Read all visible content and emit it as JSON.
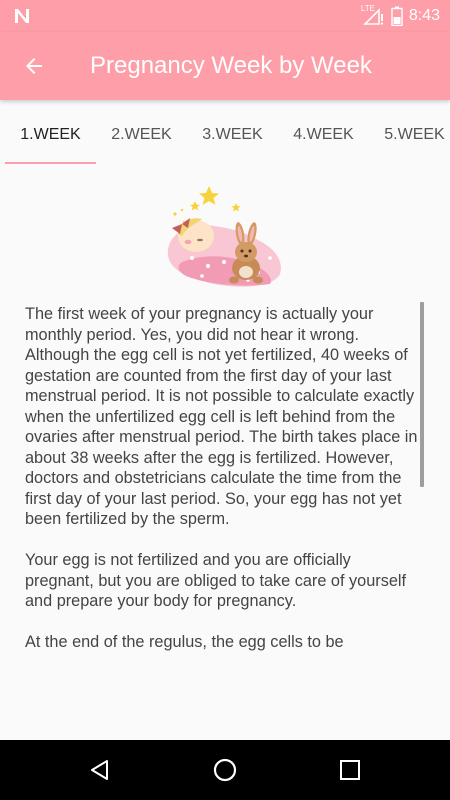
{
  "status_bar": {
    "network_label": "LTE",
    "time": "8:43"
  },
  "app_bar": {
    "title": "Pregnancy Week by Week"
  },
  "tabs": [
    {
      "label": "1.WEEK",
      "active": true
    },
    {
      "label": "2.WEEK",
      "active": false
    },
    {
      "label": "3.WEEK",
      "active": false
    },
    {
      "label": "4.WEEK",
      "active": false
    },
    {
      "label": "5.WEEK",
      "active": false
    }
  ],
  "article": {
    "paragraphs": [
      "The first week of your pregnancy is actually your monthly period. Yes, you did not hear it wrong. Although the egg cell is not yet fertilized, 40 weeks of gestation are counted from the first day of your last menstrual period. It is not possible to calculate exactly when the unfertilized egg cell is left behind from the ovaries after menstrual period. The birth takes place in about 38 weeks after the egg is fertilized. However, doctors and obstetricians calculate the time from the first day of your last period. So, your egg has not yet been fertilized by the sperm.",
      "Your egg is not fertilized and you are officially pregnant, but you are obliged to take care of yourself and prepare your body for pregnancy.",
      "At the end of the regulus, the egg cells to be"
    ]
  },
  "colors": {
    "primary": "#fd9ea8",
    "text": "#444444"
  },
  "icons": {
    "back": "arrow-left-icon",
    "nav_back": "triangle-back-icon",
    "nav_home": "circle-home-icon",
    "nav_recents": "square-recents-icon"
  }
}
